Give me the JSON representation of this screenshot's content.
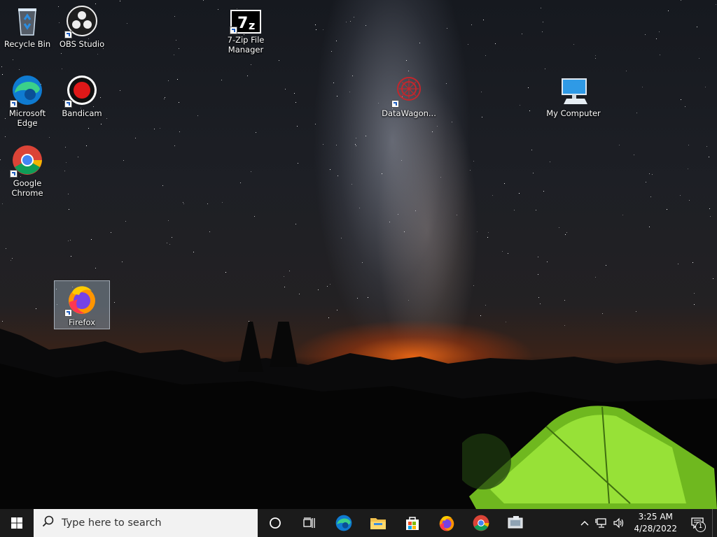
{
  "desktop": {
    "icons": [
      {
        "name": "recycle-bin",
        "label": "Recycle Bin"
      },
      {
        "name": "obs-studio",
        "label": "OBS Studio"
      },
      {
        "name": "seven-zip",
        "label": "7-Zip File Manager"
      },
      {
        "name": "microsoft-edge",
        "label": "Microsoft Edge"
      },
      {
        "name": "bandicam",
        "label": "Bandicam"
      },
      {
        "name": "datawagon",
        "label": "DataWagon..."
      },
      {
        "name": "my-computer",
        "label": "My Computer"
      },
      {
        "name": "google-chrome",
        "label": "Google Chrome"
      },
      {
        "name": "firefox",
        "label": "Firefox",
        "selected": true
      }
    ]
  },
  "taskbar": {
    "search_placeholder": "Type here to search",
    "pinned": [
      "cortana-icon",
      "task-view-icon",
      "edge-icon",
      "file-explorer-icon",
      "store-icon",
      "firefox-icon",
      "chrome-icon",
      "app-icon"
    ],
    "clock": {
      "time": "3:25 AM",
      "date": "4/28/2022"
    },
    "notifications_count": "1"
  },
  "colors": {
    "taskbar_bg": "#1b1b1b",
    "search_bg": "#f2f2f2",
    "tent_green": "#8edc2a",
    "horizon_orange": "#ff6e14"
  }
}
